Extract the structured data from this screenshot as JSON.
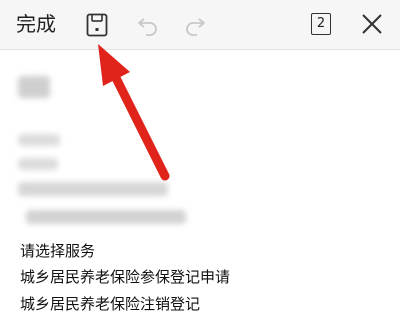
{
  "toolbar": {
    "done_label": "完成",
    "page_count": "2",
    "icons": [
      "save-icon",
      "undo-icon",
      "redo-icon",
      "page-count-icon",
      "close-icon"
    ]
  },
  "content": {
    "lines": [
      "请选择服务",
      "城乡居民养老保险参保登记申请",
      "城乡居民养老保险注销登记"
    ]
  },
  "annotation": {
    "arrow_color": "#e0241b"
  }
}
